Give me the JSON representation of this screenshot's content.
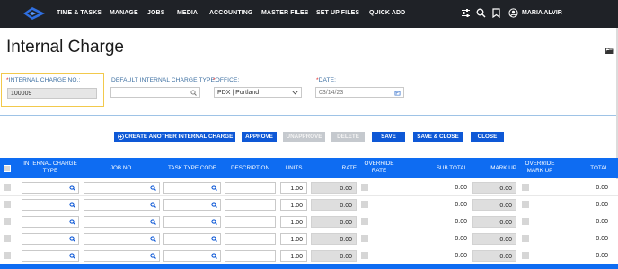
{
  "nav": {
    "items": [
      "TIME & TASKS",
      "MANAGE",
      "JOBS",
      "MEDIA",
      "ACCOUNTING",
      "MASTER FILES",
      "SET UP FILES",
      "QUICK ADD"
    ],
    "user": "MARIA ALVIR",
    "icons": [
      "sliders-icon",
      "search-icon",
      "bookmark-icon",
      "user-icon"
    ]
  },
  "page": {
    "title": "Internal Charge"
  },
  "form": {
    "charge_no": {
      "label": "INTERNAL CHARGE NO.:",
      "value": "100009"
    },
    "default_type": {
      "label": "DEFAULT INTERNAL CHARGE TYPE:",
      "value": ""
    },
    "office": {
      "label": "OFFICE:",
      "value": "PDX | Portland"
    },
    "date": {
      "label": "DATE:",
      "value": "03/14/23"
    }
  },
  "buttons": {
    "create": "CREATE ANOTHER INTERNAL CHARGE",
    "approve": "APPROVE",
    "unapprove": "UNAPPROVE",
    "delete": "DELETE",
    "save": "SAVE",
    "save_close": "SAVE & CLOSE",
    "close": "CLOSE"
  },
  "table": {
    "headers": {
      "type": "INTERNAL CHARGE TYPE",
      "job": "JOB NO.",
      "task": "TASK TYPE CODE",
      "desc": "DESCRIPTION",
      "units": "UNITS",
      "rate": "RATE",
      "override_rate": "OVERRIDE RATE",
      "subtotal": "SUB TOTAL",
      "markup": "MARK UP",
      "override_markup": "OVERRIDE MARK UP",
      "total": "TOTAL"
    },
    "rows": [
      {
        "units": "1.00",
        "rate": "0.00",
        "subtotal": "0.00",
        "markup": "0.00",
        "total": "0.00"
      },
      {
        "units": "1.00",
        "rate": "0.00",
        "subtotal": "0.00",
        "markup": "0.00",
        "total": "0.00"
      },
      {
        "units": "1.00",
        "rate": "0.00",
        "subtotal": "0.00",
        "markup": "0.00",
        "total": "0.00"
      },
      {
        "units": "1.00",
        "rate": "0.00",
        "subtotal": "0.00",
        "markup": "0.00",
        "total": "0.00"
      },
      {
        "units": "1.00",
        "rate": "0.00",
        "subtotal": "0.00",
        "markup": "0.00",
        "total": "0.00"
      }
    ]
  },
  "colors": {
    "nav_bg": "#1f2227",
    "accent": "#0e6cf2",
    "button": "#0e58d6",
    "required": "#e02020",
    "label": "#3b6ea0"
  }
}
